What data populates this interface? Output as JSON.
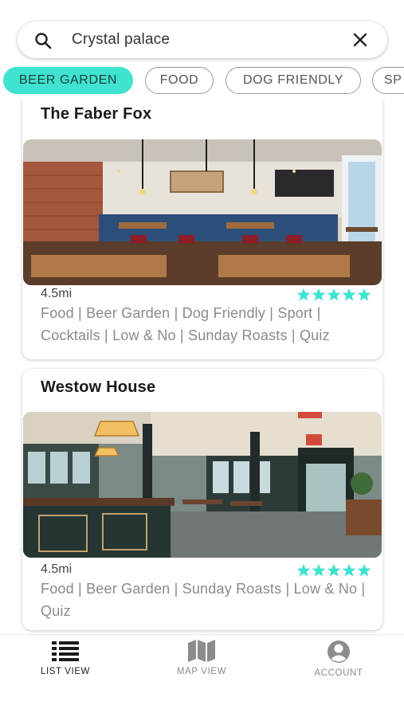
{
  "search": {
    "value": "Crystal palace",
    "placeholder": "Search"
  },
  "filters": [
    {
      "label": "BEER GARDEN",
      "active": true
    },
    {
      "label": "FOOD",
      "active": false
    },
    {
      "label": "DOG FRIENDLY",
      "active": false
    },
    {
      "label": "SP",
      "active": false
    }
  ],
  "venues": [
    {
      "name": "The Faber Fox",
      "distance": "4.5mi",
      "rating": 5,
      "tags": "Food | Beer Garden | Dog Friendly | Sport | Cocktails | Low & No | Sunday Roasts | Quiz"
    },
    {
      "name": "Westow House",
      "distance": "4.5mi",
      "rating": 5,
      "tags": "Food | Beer Garden | Sunday Roasts | Low & No | Quiz"
    }
  ],
  "nav": {
    "list": "LIST VIEW",
    "map": "MAP VIEW",
    "account": "ACCOUNT"
  },
  "colors": {
    "accent": "#3fe3d0",
    "star": "#3fe3d0"
  },
  "icons": {
    "search": "search-icon",
    "clear": "close-icon",
    "star": "star-icon",
    "list": "list-icon",
    "map": "map-icon",
    "account": "account-icon"
  }
}
